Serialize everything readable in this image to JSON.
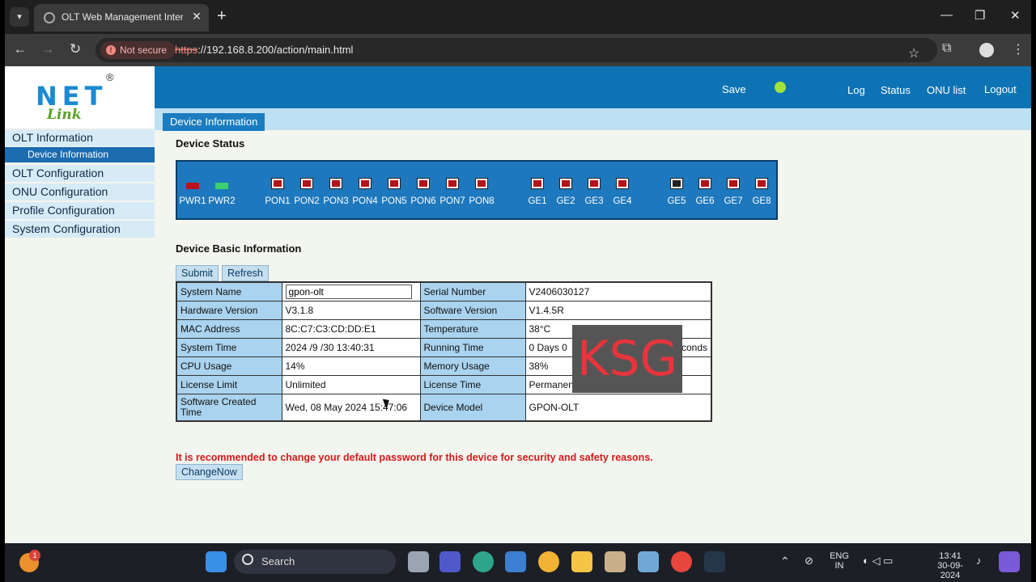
{
  "browser": {
    "tab_title": "OLT Web Management Interface",
    "tab_close": "✕",
    "new_tab": "+",
    "not_secure": "Not secure",
    "url_scheme": "https",
    "url_rest": "://192.168.8.200/action/main.html"
  },
  "logo": {
    "main": "NET",
    "sub": "Link",
    "mark": "®"
  },
  "topnav": {
    "save": "Save",
    "log": "Log",
    "status": "Status",
    "onu_list": "ONU list",
    "logout": "Logout"
  },
  "breadcrumb": "Device Information",
  "sidebar": {
    "items": [
      "OLT Information",
      "Device Information",
      "OLT Configuration",
      "ONU Configuration",
      "Profile Configuration",
      "System Configuration"
    ]
  },
  "device_status": {
    "heading": "Device Status",
    "power": [
      {
        "label": "PWR1",
        "color": "#c0101a"
      },
      {
        "label": "PWR2",
        "color": "#3ccf6e"
      }
    ],
    "pon": [
      "PON1",
      "PON2",
      "PON3",
      "PON4",
      "PON5",
      "PON6",
      "PON7",
      "PON8"
    ],
    "ge": [
      {
        "label": "GE1",
        "up": false
      },
      {
        "label": "GE2",
        "up": false
      },
      {
        "label": "GE3",
        "up": false
      },
      {
        "label": "GE4",
        "up": false
      },
      {
        "label": "GE5",
        "up": true
      },
      {
        "label": "GE6",
        "up": false
      },
      {
        "label": "GE7",
        "up": false
      },
      {
        "label": "GE8",
        "up": false
      }
    ]
  },
  "basic_info": {
    "heading": "Device Basic Information",
    "submit": "Submit",
    "refresh": "Refresh",
    "system_name_label": "System Name",
    "system_name_value": "gpon-olt",
    "serial_label": "Serial Number",
    "serial_value": "V2406030127",
    "hw_label": "Hardware Version",
    "hw_value": "V3.1.8",
    "sw_label": "Software Version",
    "sw_value": "V1.4.5R",
    "mac_label": "MAC Address",
    "mac_value": "8C:C7:C3:CD:DD:E1",
    "temp_label": "Temperature",
    "temp_value": "38°C",
    "time_label": "System Time",
    "time_value": "2024 /9 /30 13:40:31",
    "running_label": "Running Time",
    "running_value": "0 Days 0",
    "running_tail": "conds",
    "cpu_label": "CPU Usage",
    "cpu_value": "14%",
    "mem_label": "Memory Usage",
    "mem_value": "38%",
    "license_label": "License Limit",
    "license_value": "Unlimited",
    "license_time_label": "License Time",
    "license_time_value": "Permanent",
    "created_label": "Software Created Time",
    "created_value": "Wed, 08 May 2024 15:47:06",
    "model_label": "Device Model",
    "model_value": "GPON-OLT"
  },
  "watermark": "KSG",
  "warning": "It is recommended to change your default password for this device for security and safety reasons.",
  "change_now": "ChangeNow",
  "taskbar": {
    "search": "Search",
    "lang_top": "ENG",
    "lang_bottom": "IN",
    "time": "13:41",
    "date": "30-09-2024",
    "notification_count": "1"
  }
}
